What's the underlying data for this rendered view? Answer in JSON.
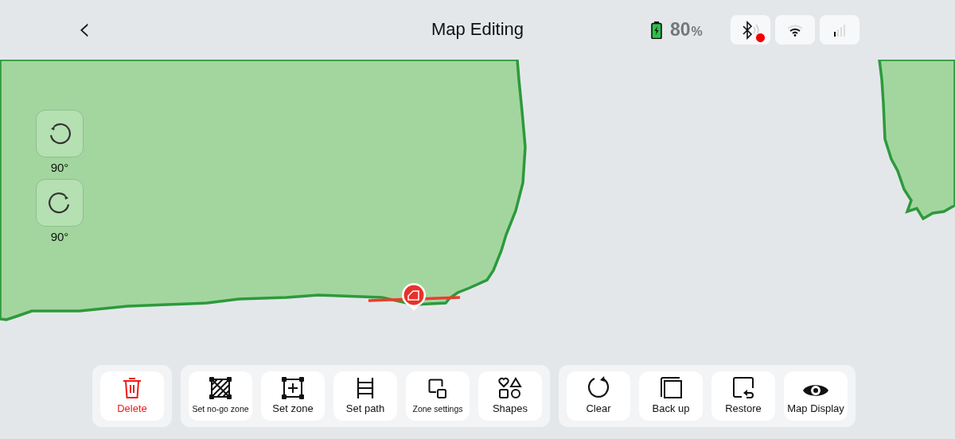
{
  "header": {
    "back": "‹",
    "title": "Map Editing",
    "battery": {
      "value": "80",
      "unit": "%"
    },
    "status_buttons": [
      {
        "kind": "bluetooth",
        "alert": true
      },
      {
        "kind": "wifi",
        "alert": false
      },
      {
        "kind": "signal",
        "alert": false
      }
    ]
  },
  "map": {
    "rotate_controls": [
      {
        "kind": "ccw",
        "label": "90°"
      },
      {
        "kind": "cw",
        "label": "90°"
      }
    ],
    "marker": {
      "selected": true
    }
  },
  "toolbar": {
    "groups": [
      {
        "tools": [
          {
            "kind": "trash",
            "label": "Delete",
            "danger": true
          }
        ]
      },
      {
        "tools": [
          {
            "kind": "hatch",
            "label": "Set no-go zone",
            "danger": false
          },
          {
            "kind": "zone",
            "label": "Set zone",
            "danger": false
          },
          {
            "kind": "ladder",
            "label": "Set path",
            "danger": false
          },
          {
            "kind": "zones",
            "label": "Zone settings",
            "danger": false
          },
          {
            "kind": "shapes",
            "label": "Shapes",
            "danger": false
          }
        ]
      },
      {
        "tools": [
          {
            "kind": "circle",
            "label": "Clear",
            "danger": false
          },
          {
            "kind": "copy",
            "label": "Back up",
            "danger": false
          },
          {
            "kind": "restore",
            "label": "Restore",
            "danger": false
          },
          {
            "kind": "eye",
            "label": "Map Display",
            "danger": false
          }
        ]
      }
    ]
  }
}
